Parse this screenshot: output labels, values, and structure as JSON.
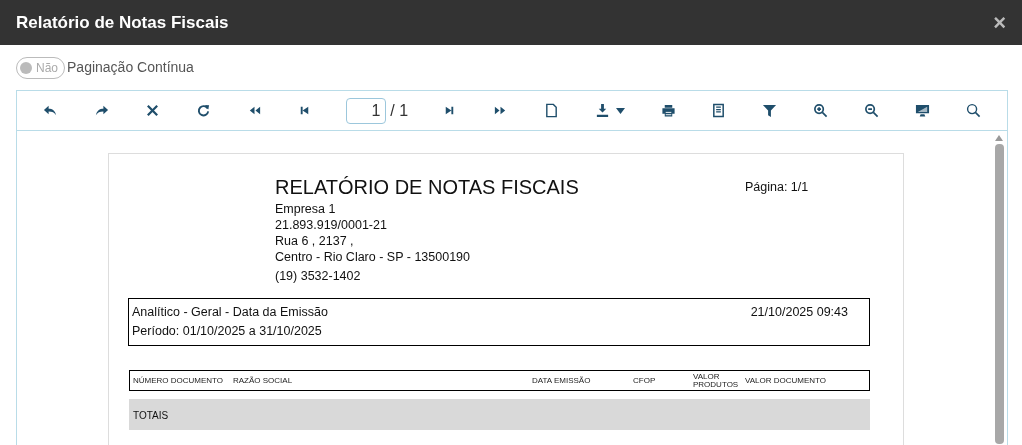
{
  "window": {
    "title": "Relatório de Notas Fiscais",
    "close": "×"
  },
  "continuous_paging": {
    "on": false,
    "state_label": "Não",
    "label": "Paginação Contínua"
  },
  "pager": {
    "page": "1",
    "total": "/ 1"
  },
  "report": {
    "title": "RELATÓRIO DE NOTAS FISCAIS",
    "page_label": "Página: 1/1",
    "company": [
      "Empresa 1",
      "21.893.919/0001-21",
      "Rua 6 , 2137 ,",
      "Centro - Rio Claro - SP - 13500190",
      "(19) 3532-1402"
    ],
    "filter": "Analítico - Geral - Data da Emissão",
    "generated": "21/10/2025 09:43",
    "period": "Período:  01/10/2025 a 31/10/2025",
    "columns": [
      "NÚMERO DOCUMENTO",
      "RAZÃO SOCIAL",
      "DATA EMISSÃO",
      "CFOP",
      "VALOR PRODUTOS",
      "VALOR DOCUMENTO"
    ],
    "totals_label": "TOTAIS"
  }
}
